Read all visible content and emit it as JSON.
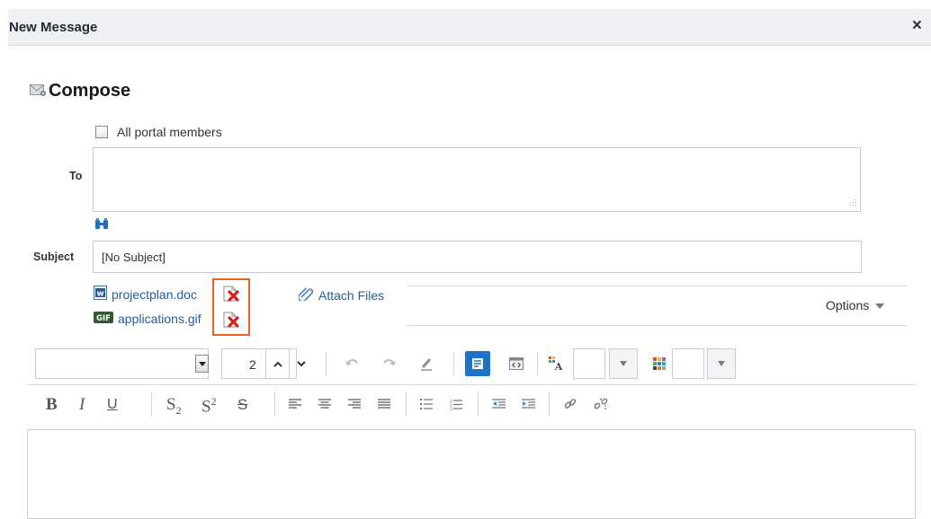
{
  "window": {
    "title": "New Message",
    "close_label": "×"
  },
  "compose": {
    "title": "Compose"
  },
  "recipients": {
    "all_members_label": "All portal members",
    "to_label": "To",
    "to_value": ""
  },
  "subject": {
    "label": "Subject",
    "value": "[No Subject]"
  },
  "attachments": [
    {
      "name": "projectplan.doc",
      "type_icon": "word-doc-icon"
    },
    {
      "name": "applications.gif",
      "type_icon": "gif-file-icon"
    }
  ],
  "attach_files_label": "Attach Files",
  "options_label": "Options",
  "toolbar": {
    "font_name": "",
    "font_size": "2"
  },
  "colors": {
    "highlight": "#e8632a",
    "link": "#1f5f9e",
    "active": "#1e73c8"
  }
}
